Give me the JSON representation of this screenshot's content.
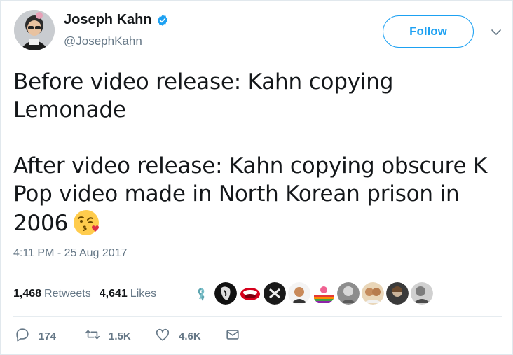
{
  "author": {
    "name": "Joseph Kahn",
    "handle": "@JosephKahn",
    "verified": true
  },
  "follow_label": "Follow",
  "tweet_lines": {
    "l1": "Before video release: Kahn copying",
    "l2": "Lemonade",
    "l3": "After video release: Kahn copying obscure K",
    "l4": "Pop video made in North Korean prison in",
    "l5": "2006"
  },
  "emoji": "face-blowing-kiss",
  "timestamp": "4:11 PM - 25 Aug 2017",
  "stats": {
    "retweets_count": "1,468",
    "retweets_label": "Retweets",
    "likes_count": "4,641",
    "likes_label": "Likes"
  },
  "liker_avatars": 10,
  "actions": {
    "replies": "174",
    "retweets": "1.5K",
    "likes": "4.6K"
  },
  "colors": {
    "accent": "#1da1f2",
    "secondary_text": "#657786",
    "primary_text": "#14171a",
    "border": "#e1e8ed"
  }
}
